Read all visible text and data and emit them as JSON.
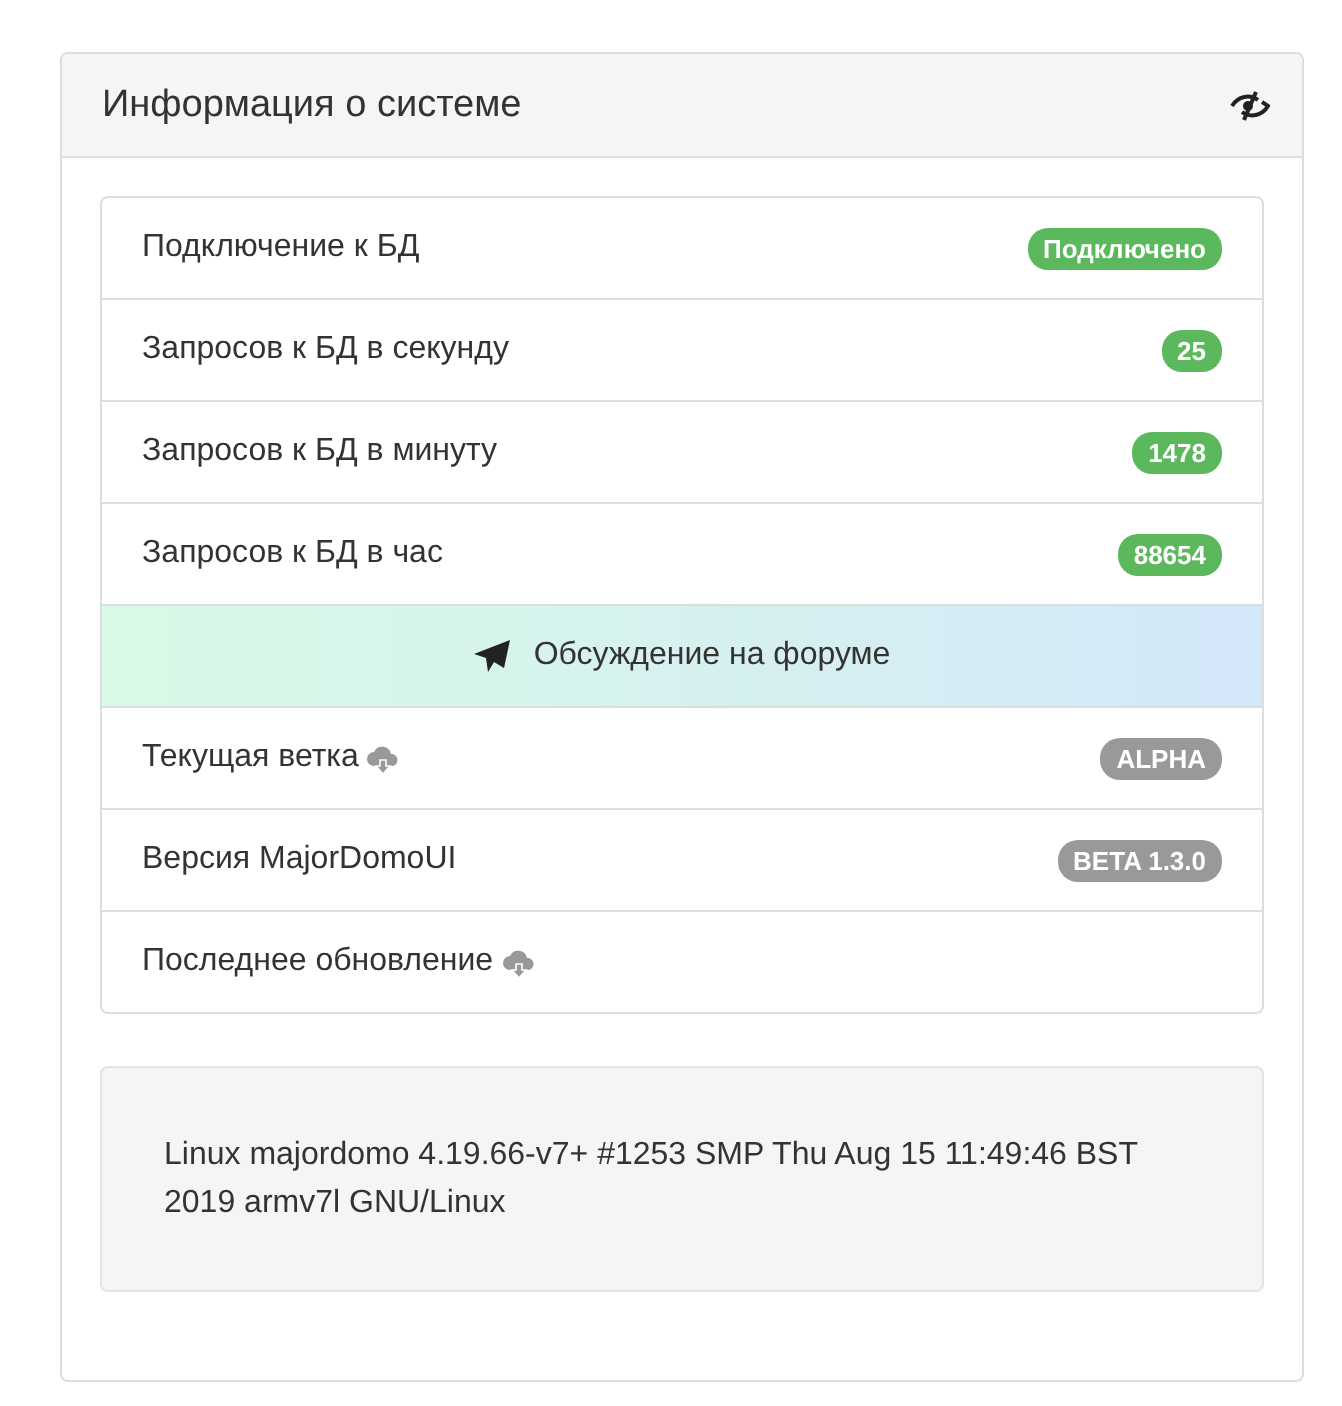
{
  "panel": {
    "title": "Информация о системе"
  },
  "rows": [
    {
      "kind": "info",
      "label": "Подключение к БД",
      "badge": {
        "text": "Подключено",
        "color": "#5cb85c"
      }
    },
    {
      "kind": "info",
      "label": "Запросов к БД в секунду",
      "badge": {
        "text": "25",
        "color": "#5cb85c"
      }
    },
    {
      "kind": "info",
      "label": "Запросов к БД в минуту",
      "badge": {
        "text": "1478",
        "color": "#5cb85c"
      }
    },
    {
      "kind": "info",
      "label": "Запросов к БД в час",
      "badge": {
        "text": "88654",
        "color": "#5cb85c"
      }
    },
    {
      "kind": "link",
      "label": "Обсуждение на форуме"
    },
    {
      "kind": "update",
      "label": "Текущая ветка",
      "badge": {
        "text": "ALPHA",
        "color": "#999999"
      }
    },
    {
      "kind": "info",
      "label": "Версия MajorDomoUI",
      "badge": {
        "text": "BETA 1.3.0",
        "color": "#999999"
      }
    },
    {
      "kind": "update",
      "label": "Последнее обновление"
    }
  ],
  "system_info": "Linux majordomo 4.19.66-v7+ #1253 SMP Thu Aug 15 11:49:46 BST 2019 armv7l GNU/Linux"
}
